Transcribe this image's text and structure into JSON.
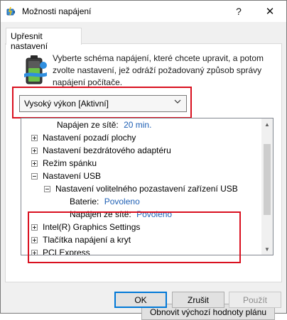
{
  "window": {
    "title": "Možnosti napájení",
    "help_glyph": "?",
    "close_glyph": "✕"
  },
  "tab": {
    "label": "Upřesnit nastavení"
  },
  "description": "Vyberte schéma napájení, které chcete upravit, a potom zvolte nastavení, jež odráží požadovaný způsob správy napájení počítače.",
  "plan_dropdown": {
    "selected": "Vysoký výkon [Aktivní]"
  },
  "tree": {
    "rows": [
      {
        "label": "Napájen ze sítě:",
        "value": "20 min."
      },
      {
        "label": "Nastavení pozadí plochy"
      },
      {
        "label": "Nastavení bezdrátového adaptéru"
      },
      {
        "label": "Režim spánku"
      },
      {
        "label": "Nastavení USB"
      },
      {
        "label": "Nastavení volitelného pozastavení zařízení USB"
      },
      {
        "label": "Baterie:",
        "value": "Povoleno"
      },
      {
        "label": "Napájen ze sítě:",
        "value": "Povoleno"
      },
      {
        "label": "Intel(R) Graphics Settings"
      },
      {
        "label": "Tlačítka napájení a kryt"
      },
      {
        "label": "PCI Express"
      }
    ]
  },
  "buttons": {
    "restore": "Obnovit výchozí hodnoty plánu",
    "ok": "OK",
    "cancel": "Zrušit",
    "apply": "Použít"
  },
  "colors": {
    "highlight_box": "#d9101f",
    "value_text": "#1e5fb4"
  }
}
